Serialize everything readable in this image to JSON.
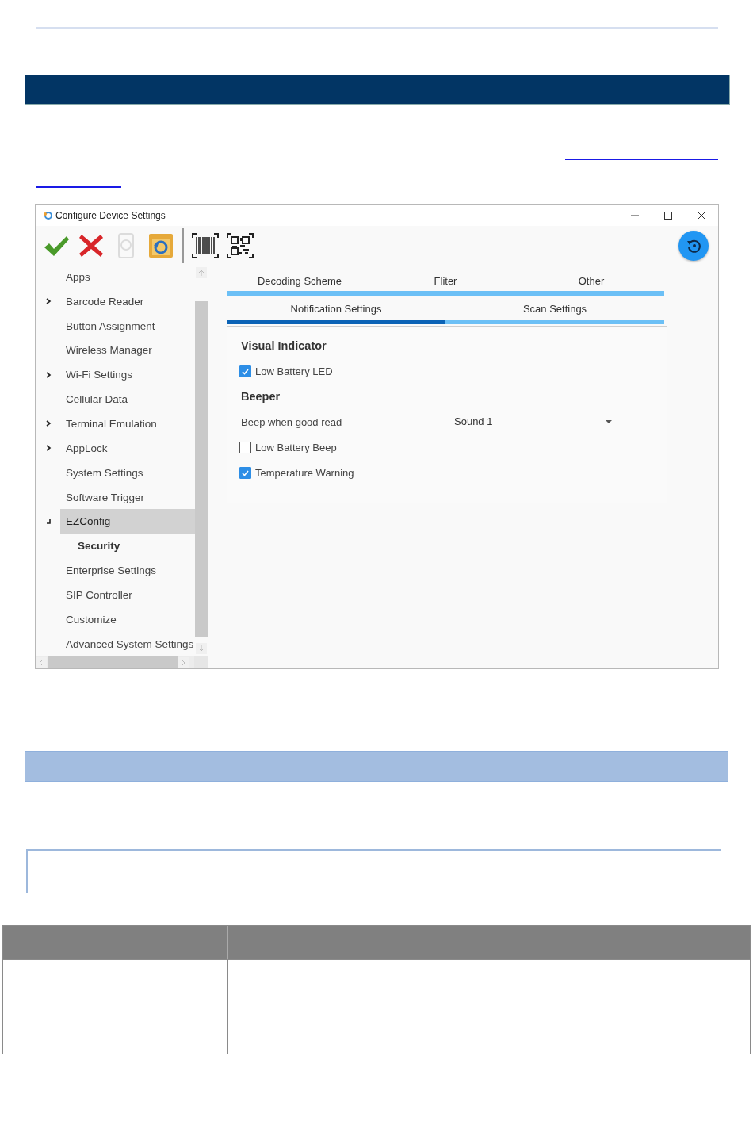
{
  "window": {
    "title": "Configure Device Settings"
  },
  "toolbar": [
    {
      "kind": "apply",
      "disabled": false
    },
    {
      "kind": "cancel",
      "disabled": false
    },
    {
      "kind": "device",
      "disabled": true
    },
    {
      "kind": "restore",
      "disabled": false
    },
    {
      "kind": "separator"
    },
    {
      "kind": "barcode",
      "disabled": false
    },
    {
      "kind": "qrcode",
      "disabled": false
    }
  ],
  "sidebar": {
    "items": [
      {
        "label": "Apps",
        "selected": false
      },
      {
        "label": "Barcode Reader",
        "selected": false,
        "expanded": false
      },
      {
        "label": "Button Assignment",
        "selected": false
      },
      {
        "label": "Wireless Manager",
        "selected": false
      },
      {
        "label": "Wi-Fi Settings",
        "selected": false,
        "expanded": false
      },
      {
        "label": "Cellular Data",
        "selected": false
      },
      {
        "label": "Terminal Emulation",
        "selected": false,
        "expanded": false
      },
      {
        "label": "AppLock",
        "selected": false,
        "expanded": false
      },
      {
        "label": "System Settings",
        "selected": false
      },
      {
        "label": "Software Trigger",
        "selected": false
      },
      {
        "label": "EZConfig",
        "selected": true,
        "expanded": true,
        "children": [
          {
            "label": "Security",
            "selected": false
          }
        ]
      },
      {
        "label": "Enterprise Settings",
        "selected": false
      },
      {
        "label": "SIP Controller",
        "selected": false
      },
      {
        "label": "Customize",
        "selected": false
      },
      {
        "label": "Advanced System Settings",
        "selected": false
      }
    ]
  },
  "tab_rows": [
    [
      {
        "label": "Decoding Scheme",
        "selected": false
      },
      {
        "label": "Fliter",
        "selected": false
      },
      {
        "label": "Other",
        "selected": false
      }
    ],
    [
      {
        "label": "Notification Settings",
        "selected": true
      },
      {
        "label": "Scan Settings",
        "selected": false
      }
    ]
  ],
  "panel": {
    "rows": [
      {
        "kind": "heading",
        "label": "Visual Indicator"
      },
      {
        "kind": "checkbox",
        "label": "Low Battery LED",
        "checked": true
      },
      {
        "kind": "heading",
        "label": "Beeper"
      },
      {
        "kind": "dropdown",
        "label": "Beep when good read",
        "value": "Sound 1"
      },
      {
        "kind": "checkbox",
        "label": "Low Battery Beep",
        "checked": false
      },
      {
        "kind": "checkbox",
        "label": "Temperature Warning",
        "checked": true
      }
    ]
  }
}
